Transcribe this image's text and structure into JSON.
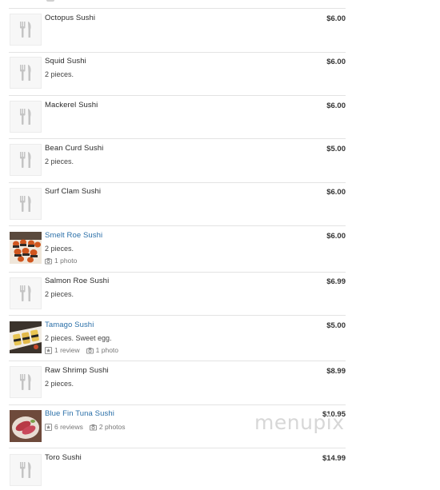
{
  "items": [
    {
      "name": "Octopus Sushi",
      "desc": "",
      "price": "$6.00",
      "photo": false
    },
    {
      "name": "Squid Sushi",
      "desc": "2 pieces.",
      "price": "$6.00",
      "photo": false
    },
    {
      "name": "Mackerel Sushi",
      "desc": "",
      "price": "$6.00",
      "photo": false
    },
    {
      "name": "Bean Curd Sushi",
      "desc": "2 pieces.",
      "price": "$5.00",
      "photo": false
    },
    {
      "name": "Surf Clam Sushi",
      "desc": "",
      "price": "$6.00",
      "photo": false
    },
    {
      "name": "Smelt Roe Sushi",
      "desc": "2 pieces.",
      "price": "$6.00",
      "photo": true,
      "photos": "1 photo"
    },
    {
      "name": "Salmon Roe Sushi",
      "desc": "2 pieces.",
      "price": "$6.99",
      "photo": false
    },
    {
      "name": "Tamago Sushi",
      "desc": "2 pieces. Sweet egg.",
      "price": "$5.00",
      "photo": true,
      "reviews": "1 review",
      "photos": "1 photo"
    },
    {
      "name": "Raw Shrimp Sushi",
      "desc": "2 pieces.",
      "price": "$8.99",
      "photo": false
    },
    {
      "name": "Blue Fin Tuna Sushi",
      "desc": "",
      "price": "$10.95",
      "photo": true,
      "reviews": "6 reviews",
      "photos": "2 photos"
    },
    {
      "name": "Toro Sushi",
      "desc": "",
      "price": "$14.99",
      "photo": false
    }
  ],
  "watermark": "menupix",
  "icons": {
    "placeholder": "fork-knife-icon",
    "camera": "camera-icon",
    "review": "review-icon"
  },
  "colors": {
    "link": "#2a6fa8",
    "divider": "#e3e3e3",
    "muted": "#777777",
    "watermark": "#d7d7d7"
  }
}
